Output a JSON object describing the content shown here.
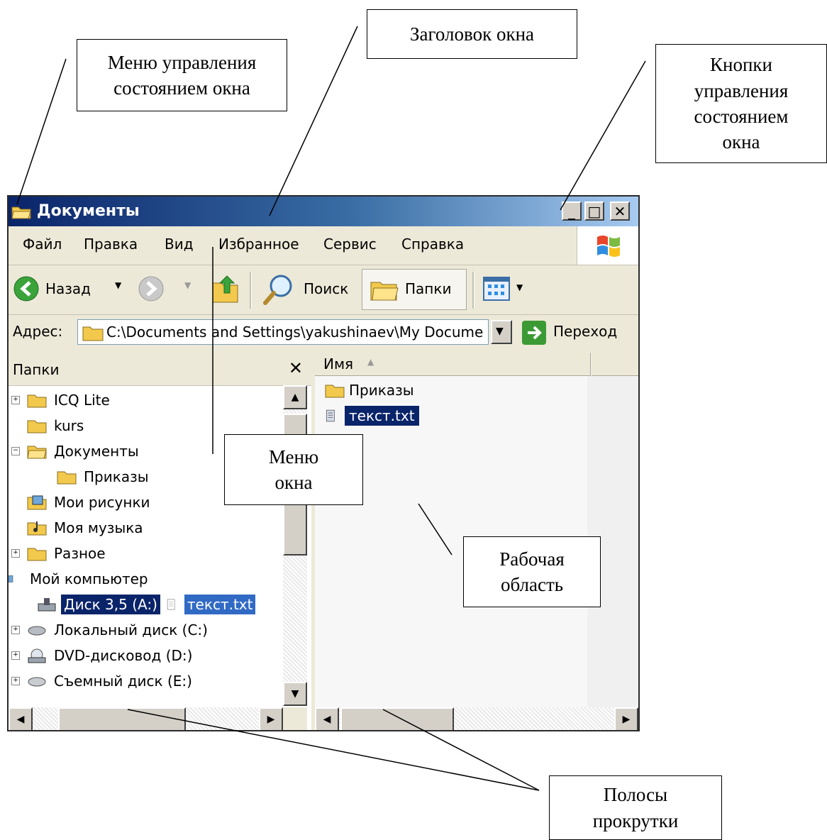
{
  "callouts": {
    "system_menu": "Меню управления\nсостоянием окна",
    "title_bar": "Заголовок окна",
    "window_buttons": "Кнопки\nуправления\nсостоянием\nокна",
    "window_menu": "Меню\nокна",
    "work_area": "Рабочая\nобласть",
    "scrollbars": "Полосы\nпрокрутки"
  },
  "window": {
    "title": "Документы",
    "controls": {
      "minimize": "_",
      "maximize": "□",
      "close": "✕"
    }
  },
  "menu": [
    "Файл",
    "Правка",
    "Вид",
    "Избранное",
    "Сервис",
    "Справка"
  ],
  "toolbar": {
    "back": "Назад",
    "search": "Поиск",
    "folders": "Папки"
  },
  "address": {
    "label": "Адрес:",
    "value": "C:\\Documents and Settings\\yakushinaev\\My Docume",
    "go": "Переход"
  },
  "folders_pane": {
    "title": "Папки",
    "close": "✕",
    "items": [
      {
        "label": "ICQ Lite",
        "expander": "+"
      },
      {
        "label": "kurs",
        "expander": ""
      },
      {
        "label": "Документы",
        "expander": "−"
      },
      {
        "label": "Приказы",
        "expander": ""
      },
      {
        "label": "Мои рисунки",
        "expander": ""
      },
      {
        "label": "Моя музыка",
        "expander": ""
      },
      {
        "label": "Разное",
        "expander": "+"
      },
      {
        "label": "Мой компьютер",
        "expander": ""
      },
      {
        "label": "Диск 3,5 (A:)",
        "expander": "",
        "selected": true
      },
      {
        "label": "Локальный диск (C:)",
        "expander": "+"
      },
      {
        "label": "DVD-дисковод (D:)",
        "expander": "+"
      },
      {
        "label": "Съемный диск (E:)",
        "expander": "+"
      }
    ],
    "drag_label": "текст.txt"
  },
  "files_pane": {
    "column": "Имя",
    "items": [
      "Приказы",
      "текст.txt"
    ]
  },
  "colors": {
    "title_start": "#0a246a",
    "title_end": "#a6caf0",
    "selection": "#0a246a",
    "face": "#ece9d8"
  }
}
